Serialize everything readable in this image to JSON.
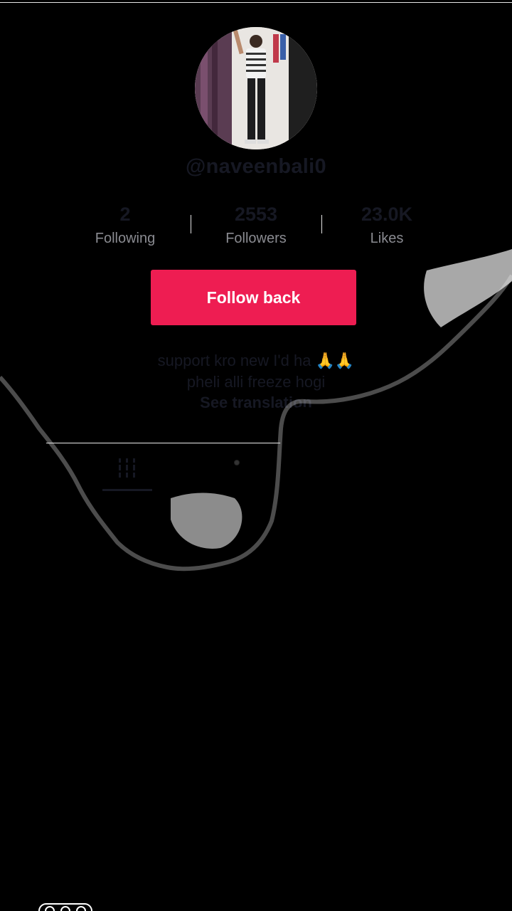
{
  "profile": {
    "username": "@naveenbali0",
    "stats": [
      {
        "value": "2",
        "label": "Following"
      },
      {
        "value": "2553",
        "label": "Followers"
      },
      {
        "value": "23.0K",
        "label": "Likes"
      }
    ],
    "follow_button": "Follow back",
    "bio_line1": "support kro new I'd ha 🙏🙏",
    "bio_line2": "pheli alli freeze hogi",
    "see_translation": "See translation"
  },
  "tabs": [
    {
      "icon": "grid-videos-icon",
      "active": true
    },
    {
      "icon": "liked-videos-icon",
      "active": false
    }
  ],
  "colors": {
    "accent": "#ee1d52",
    "text": "#161823",
    "muted": "#8a8b91",
    "overlay": "#000000"
  }
}
